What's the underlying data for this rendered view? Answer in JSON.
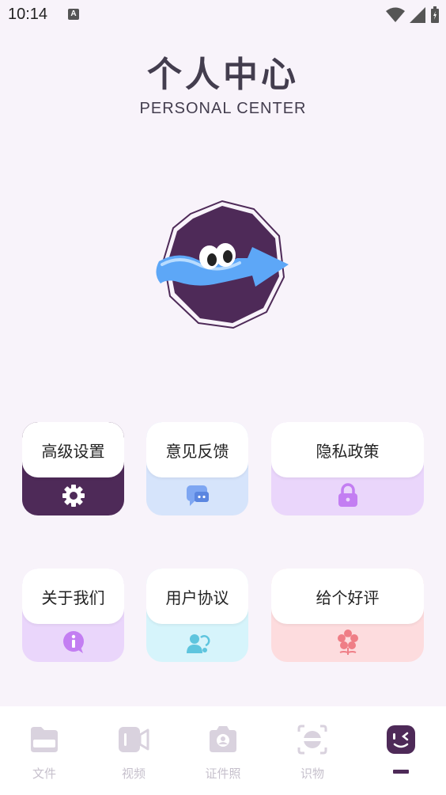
{
  "status": {
    "time": "10:14",
    "a_badge": "A"
  },
  "header": {
    "title": "个人中心",
    "subtitle": "PERSONAL CENTER"
  },
  "avatar": {
    "icon": "wavy-arrow-with-eyes-avatar"
  },
  "cards": [
    {
      "label": "高级设置",
      "icon": "gear-icon",
      "color": "#4e2a58"
    },
    {
      "label": "意见反馈",
      "icon": "chat-icon",
      "color": "#d6e4fb"
    },
    {
      "label": "隐私政策",
      "icon": "lock-icon",
      "color": "#ead6fb"
    },
    {
      "label": "关于我们",
      "icon": "info-icon",
      "color": "#ead6fb"
    },
    {
      "label": "用户协议",
      "icon": "user-icon",
      "color": "#d6f4fb"
    },
    {
      "label": "给个好评",
      "icon": "flower-icon",
      "color": "#fddcde"
    }
  ],
  "tabs": [
    {
      "label": "文件",
      "icon": "folder-icon"
    },
    {
      "label": "视频",
      "icon": "video-icon"
    },
    {
      "label": "证件照",
      "icon": "camera-icon"
    },
    {
      "label": "识物",
      "icon": "scan-icon"
    },
    {
      "label": "",
      "icon": "face-icon",
      "active": true
    }
  ]
}
